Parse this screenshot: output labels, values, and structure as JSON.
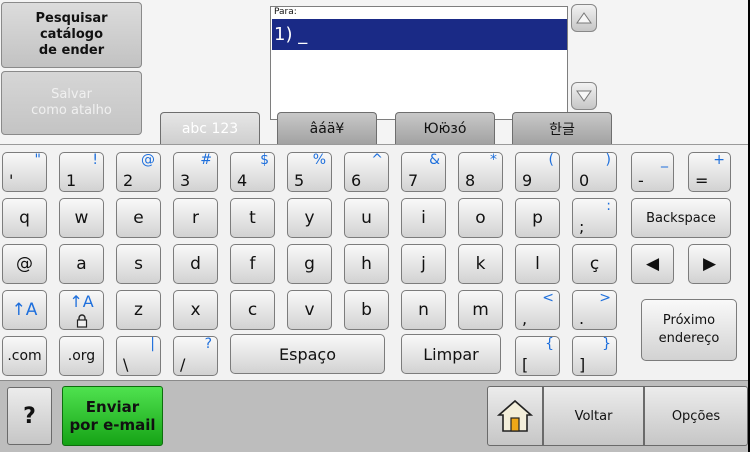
{
  "side": {
    "search_label": "Pesquisar\ncatálogo\nde ender",
    "save_label": "Salvar\ncomo atalho"
  },
  "recipient": {
    "label": "Para:",
    "entry": "1) _"
  },
  "tabs": [
    "abc 123",
    "âáä¥",
    "Юю̈зó",
    "한글"
  ],
  "keys": {
    "apostrophe": {
      "pri": "'",
      "sec": "\""
    },
    "one": {
      "pri": "1",
      "sec": "!"
    },
    "two": {
      "pri": "2",
      "sec": "@"
    },
    "three": {
      "pri": "3",
      "sec": "#"
    },
    "four": {
      "pri": "4",
      "sec": "$"
    },
    "five": {
      "pri": "5",
      "sec": "%"
    },
    "six": {
      "pri": "6",
      "sec": "^"
    },
    "seven": {
      "pri": "7",
      "sec": "&"
    },
    "eight": {
      "pri": "8",
      "sec": "*"
    },
    "nine": {
      "pri": "9",
      "sec": "("
    },
    "zero": {
      "pri": "0",
      "sec": ")"
    },
    "minus": {
      "pri": "-",
      "sec": "_"
    },
    "equals": {
      "pri": "=",
      "sec": "+"
    },
    "q": "q",
    "w": "w",
    "e": "e",
    "r": "r",
    "t": "t",
    "y": "y",
    "u": "u",
    "i": "i",
    "o": "o",
    "p": "p",
    "semicolon": {
      "pri": ";",
      "sec": ":"
    },
    "backspace": "Backspace",
    "at": "@",
    "a": "a",
    "s": "s",
    "d": "d",
    "f": "f",
    "g": "g",
    "h": "h",
    "j": "j",
    "k": "k",
    "l": "l",
    "cedilla": "ç",
    "left_arrow": "◀",
    "right_arrow": "▶",
    "shift": "↑A",
    "caps": "↑A",
    "z": "z",
    "x": "x",
    "c": "c",
    "v": "v",
    "b": "b",
    "n": "n",
    "m": "m",
    "comma": {
      "pri": ",",
      "sec": "<"
    },
    "period": {
      "pri": ".",
      "sec": ">"
    },
    "next_address": "Próximo\nendereço",
    "dotcom": ".com",
    "dotorg": ".org",
    "backslash": {
      "pri": "\\",
      "sec": "|"
    },
    "slash": {
      "pri": "/",
      "sec": "?"
    },
    "space": "Espaço",
    "clear": "Limpar",
    "lbracket": {
      "pri": "[",
      "sec": "{"
    },
    "rbracket": {
      "pri": "]",
      "sec": "}"
    }
  },
  "bottom": {
    "help": "?",
    "send": "Enviar\npor e-mail",
    "back": "Voltar",
    "options": "Opções"
  },
  "icons": {
    "scroll_up": "triangle-up-icon",
    "scroll_down": "triangle-down-icon",
    "home": "home-icon",
    "lock": "lock-icon"
  },
  "colors": {
    "selection": "#1a2a86",
    "secondary_char": "#1e6fdc",
    "send_button": "#22b822"
  }
}
